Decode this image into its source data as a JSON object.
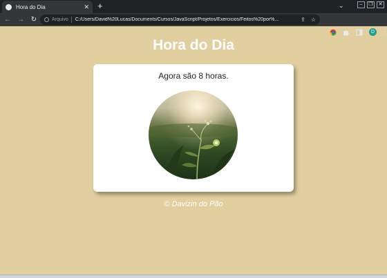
{
  "browser": {
    "tab_title": "Hora do Dia",
    "scheme_label": "Arquivo",
    "url": "C:/Users/David%20Lucas/Documents/Cursos/JavaScript/Projetos/Exercicios/Feitos%20por%...",
    "profile_initial": "D"
  },
  "page": {
    "title": "Hora do Dia",
    "message": "Agora são 8 horas.",
    "footer": "© Davizin do Pão"
  }
}
